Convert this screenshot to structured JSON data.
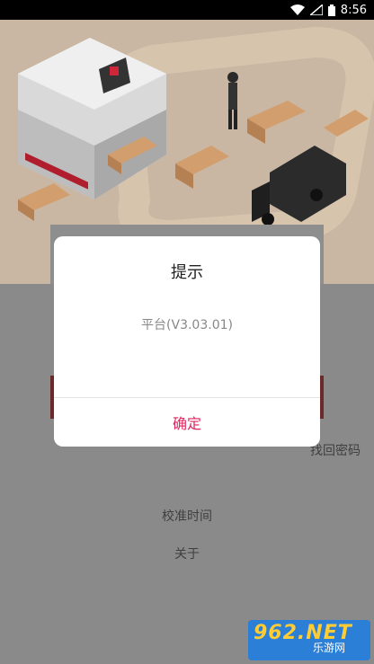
{
  "status_bar": {
    "time": "8:56",
    "icons": [
      "wifi-icon",
      "signal-icon",
      "battery-icon"
    ]
  },
  "dialog": {
    "title": "提示",
    "message": "平台(V3.03.01)",
    "confirm_label": "确定"
  },
  "login": {
    "forgot_password": "找回密码",
    "calibrate_time": "校准时间",
    "about": "关于"
  },
  "watermark": {
    "brand": "962.NET",
    "site": "乐游网"
  },
  "colors": {
    "accent": "#e0245e",
    "hero_bg": "#c9b6a3",
    "dim_bg": "#8a8a8a"
  }
}
